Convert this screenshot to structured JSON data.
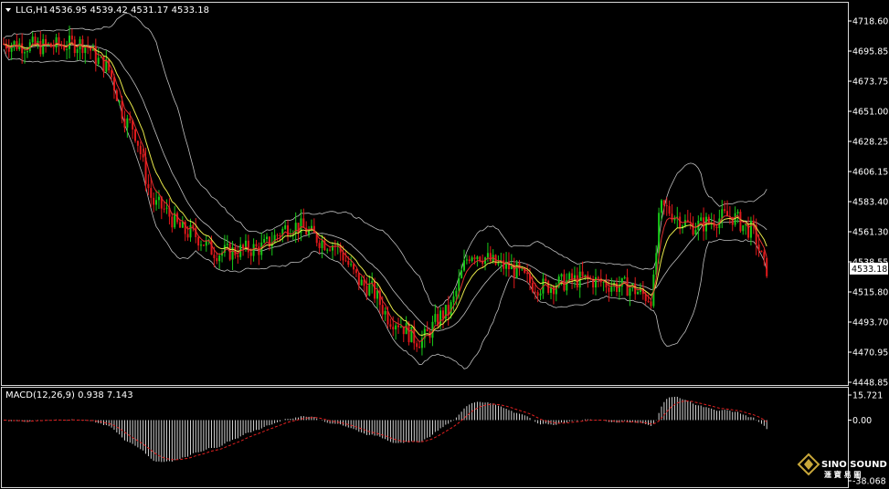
{
  "header": {
    "symbol": "LLG,H1",
    "ohlc": "4536.95 4539.42 4531.17 4533.18"
  },
  "chart_data": {
    "type": "candlestick",
    "symbol": "LLG,H1",
    "ylim": [
      4448.85,
      4727.0
    ],
    "y_ticks": [
      "4718.60",
      "4695.85",
      "4673.75",
      "4651.00",
      "4628.25",
      "4606.15",
      "4583.40",
      "4561.30",
      "4538.55",
      "4515.80",
      "4493.70",
      "4470.95",
      "4448.85"
    ],
    "last_price": "4533.18",
    "indicators": [
      "Bollinger Bands",
      "Moving Average (yellow)",
      "Moving Average (red)"
    ],
    "key_levels": [
      {
        "x": 0,
        "y": 4700
      },
      {
        "x": 16,
        "y": 4698
      },
      {
        "x": 30,
        "y": 4700
      },
      {
        "x": 38,
        "y": 4685
      },
      {
        "x": 48,
        "y": 4640
      },
      {
        "x": 58,
        "y": 4580
      },
      {
        "x": 70,
        "y": 4560
      },
      {
        "x": 82,
        "y": 4545
      },
      {
        "x": 96,
        "y": 4548
      },
      {
        "x": 110,
        "y": 4565
      },
      {
        "x": 124,
        "y": 4552
      },
      {
        "x": 138,
        "y": 4520
      },
      {
        "x": 148,
        "y": 4495
      },
      {
        "x": 158,
        "y": 4480
      },
      {
        "x": 168,
        "y": 4500
      },
      {
        "x": 178,
        "y": 4545
      },
      {
        "x": 190,
        "y": 4535
      },
      {
        "x": 204,
        "y": 4520
      },
      {
        "x": 220,
        "y": 4525
      },
      {
        "x": 236,
        "y": 4520
      },
      {
        "x": 246,
        "y": 4512
      },
      {
        "x": 250,
        "y": 4578
      },
      {
        "x": 262,
        "y": 4565
      },
      {
        "x": 276,
        "y": 4572
      },
      {
        "x": 284,
        "y": 4562
      },
      {
        "x": 290,
        "y": 4533
      }
    ],
    "macd": {
      "label": "MACD(12,26,9) 0.938 7.143",
      "ylim": [
        -38.068,
        15.721
      ],
      "y_ticks": [
        "15.721",
        "0.00",
        "-38.068"
      ]
    }
  },
  "watermark": {
    "brand": "SINO SOUND",
    "sub": "滙 寶 易 圖"
  }
}
